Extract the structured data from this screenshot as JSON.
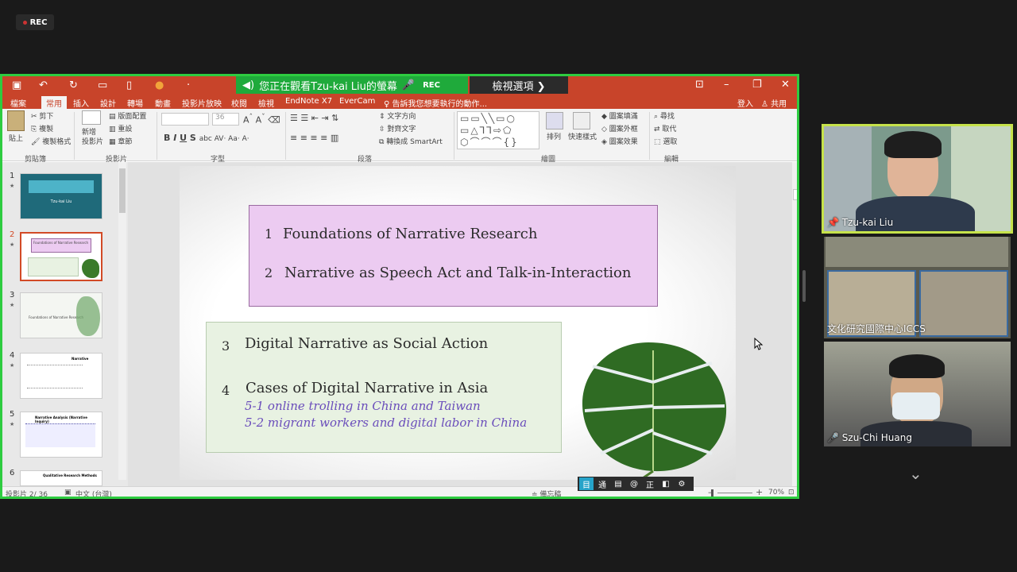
{
  "rec_label": "REC",
  "share": {
    "watching_text": "您正在觀看Tzu-kai Liu的螢幕",
    "watching_rec": "REC",
    "view_options": "檢視選項 ❯",
    "ribbon_tabs": [
      "檔案",
      "常用",
      "插入",
      "設計",
      "轉場",
      "動畫",
      "投影片放映",
      "校閱",
      "檢視",
      "EndNote X7",
      "EverCam",
      "告訴我您想要執行的動作...",
      "登入",
      "共用"
    ],
    "ribbon": {
      "paste": "貼上",
      "cut": "剪下",
      "copy": "複製",
      "format_painter": "複製格式",
      "new_slide": "新增\n投影片",
      "layout": "版面配置",
      "reset": "重設",
      "section": "章節",
      "font_size": "36",
      "text_direction": "文字方向",
      "align_text": "對齊文字",
      "smartart": "轉換成 SmartArt",
      "arrange": "排列",
      "quick_styles": "快速樣式",
      "shape_fill": "圖案填滿",
      "shape_outline": "圖案外框",
      "shape_effects": "圖案效果",
      "find": "尋找",
      "replace": "取代",
      "select": "選取",
      "groups": [
        "剪貼簿",
        "投影片",
        "字型",
        "段落",
        "繪圖",
        "編輯"
      ]
    },
    "thumbnails": [
      {
        "num": "1",
        "text": "Tzu-kai Liu"
      },
      {
        "num": "2",
        "text": "Foundations of Narrative Research"
      },
      {
        "num": "3",
        "text": "Foundations of Narrative Research"
      },
      {
        "num": "4",
        "text": "Narrative"
      },
      {
        "num": "5",
        "text": "Narrative Analysis (Narrative Inquiry)"
      },
      {
        "num": "6",
        "text": "Qualitative Research Methods"
      }
    ],
    "slide": {
      "item1_num": "1",
      "item1": "Foundations of Narrative Research",
      "item2_num": "2",
      "item2": "Narrative as Speech Act and Talk-in-Interaction",
      "item3_num": "3",
      "item3": "Digital Narrative as Social Action",
      "item4_num": "4",
      "item4": "Cases of Digital Narrative in Asia",
      "sub1": "5-1  online trolling in China and Taiwan",
      "sub2": "5-2  migrant workers and digital labor in China"
    },
    "status": {
      "slide_count": "投影片 2/ 36",
      "language": "中文 (台灣)",
      "notes": "備忘稿",
      "zoom": "70%"
    }
  },
  "participants": [
    {
      "name": "Tzu-kai Liu",
      "pinned": true
    },
    {
      "name": "文化研究國際中心ICCS",
      "pinned": false
    },
    {
      "name": "Szu-Chi Huang",
      "pinned": false
    }
  ]
}
